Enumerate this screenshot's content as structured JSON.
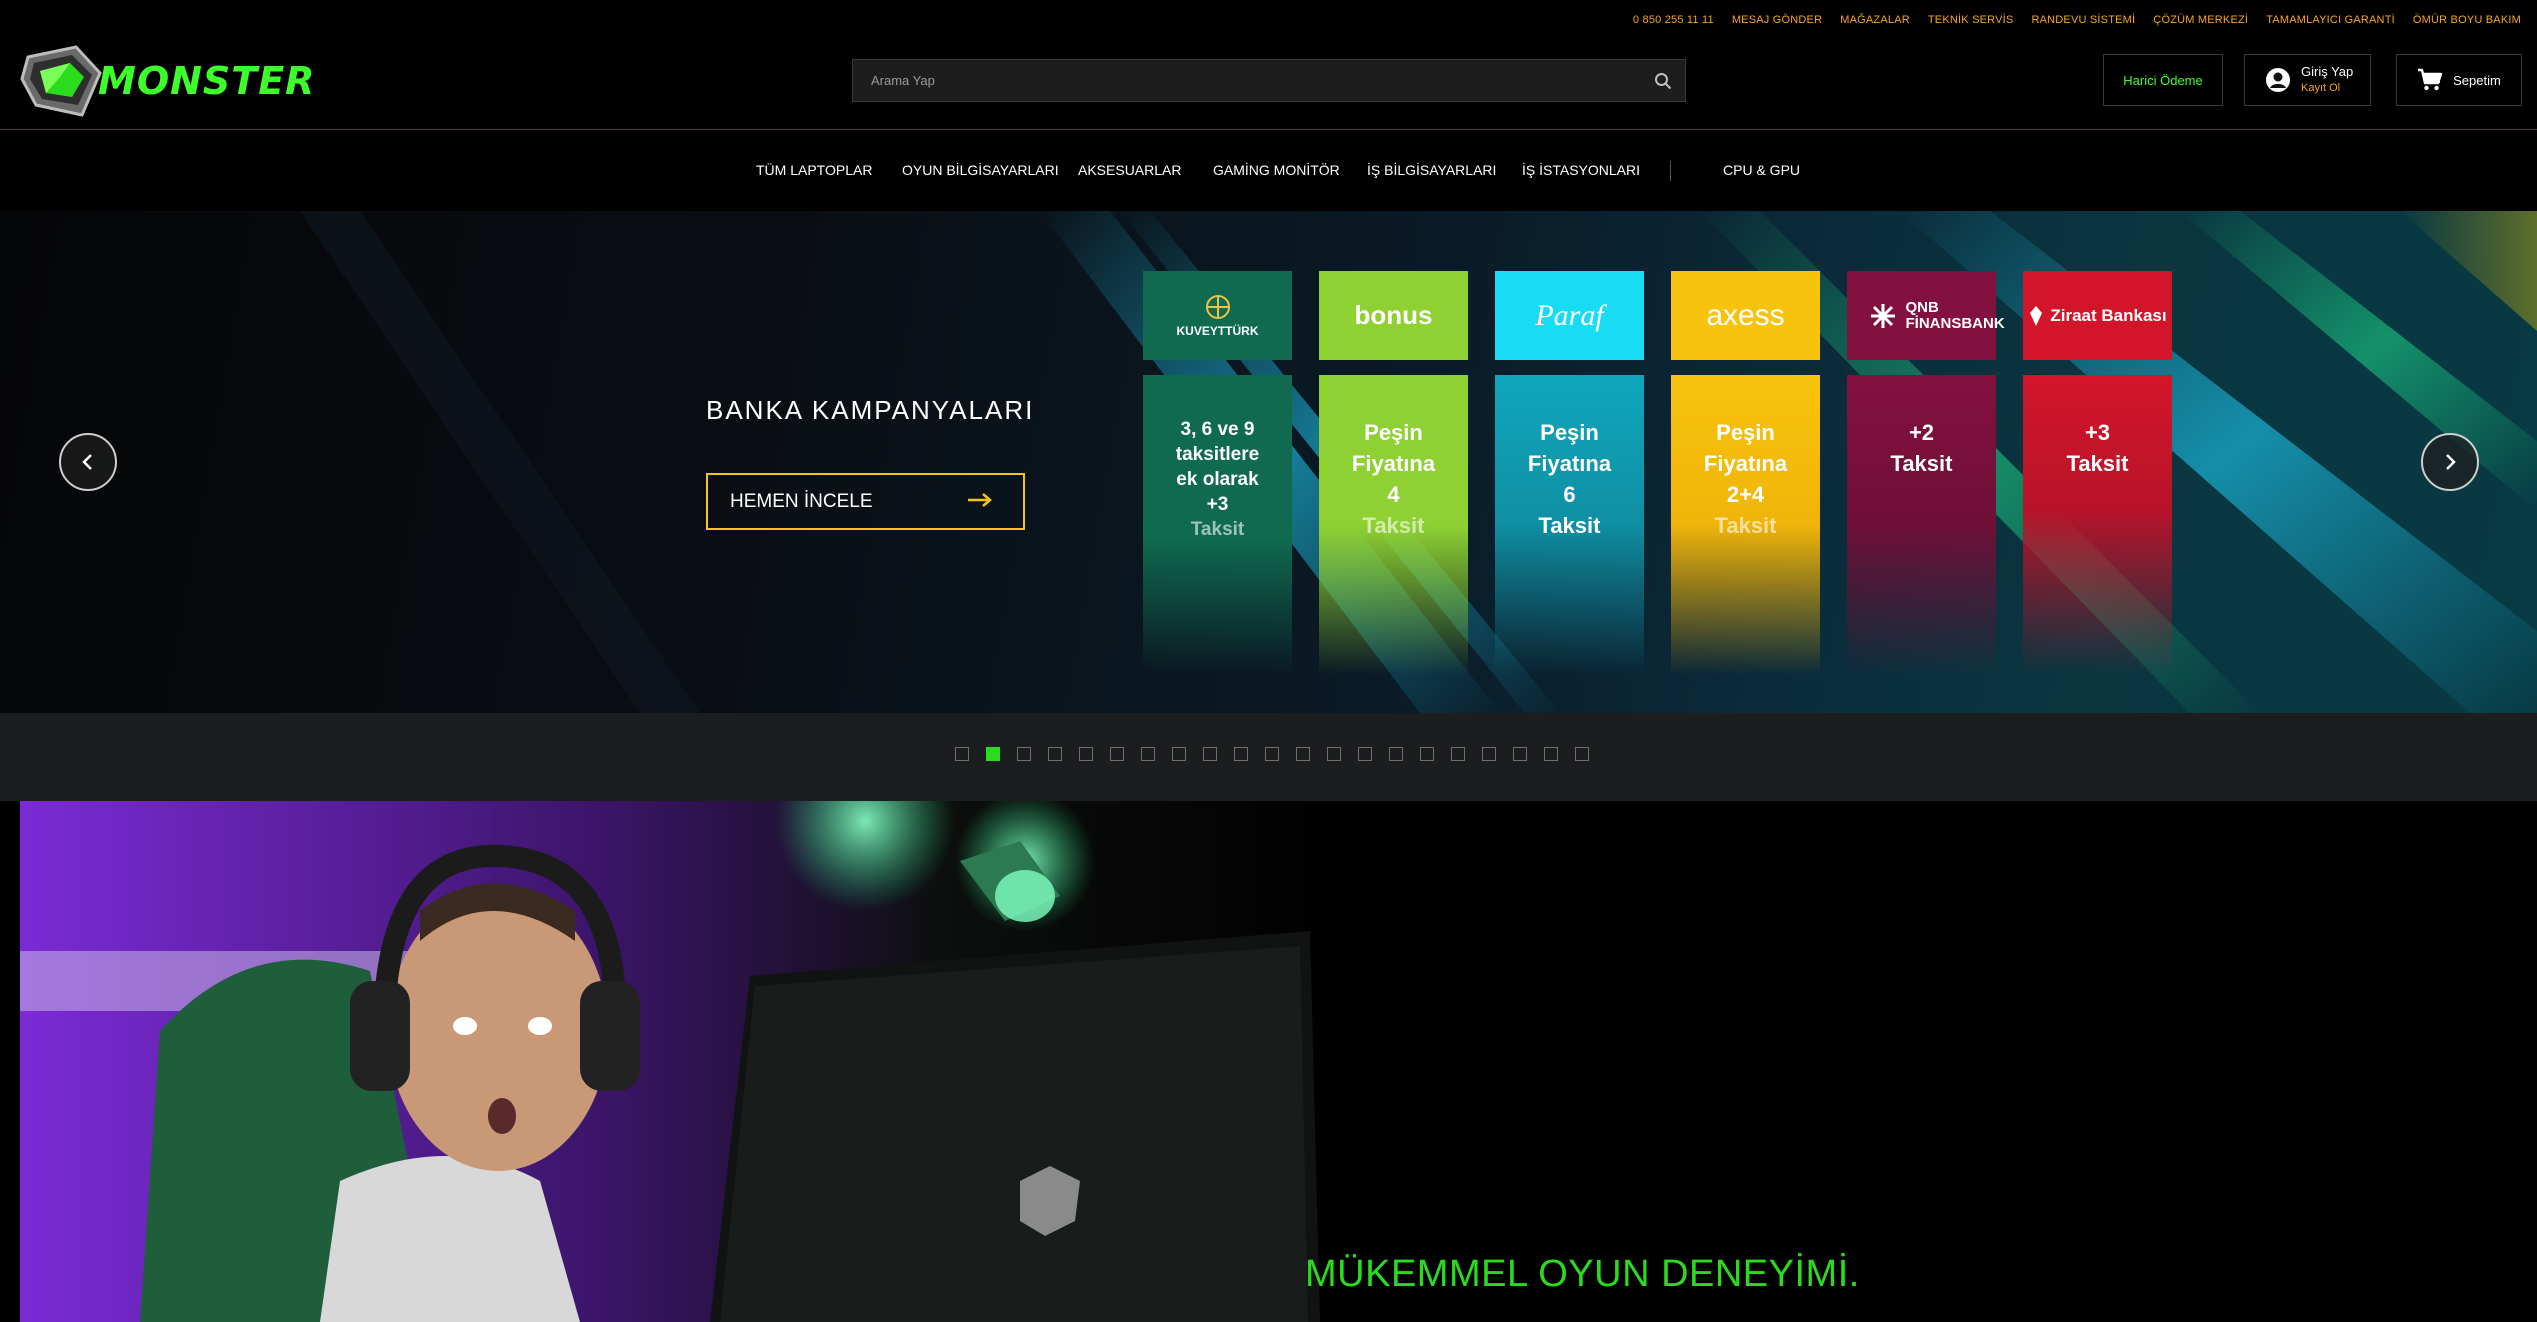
{
  "topbar": {
    "links": [
      "0 850 255 11 11",
      "MESAJ GÖNDER",
      "MAĞAZALAR",
      "TEKNİK SERVİS",
      "RANDEVU SİSTEMİ",
      "ÇÖZÜM MERKEZİ",
      "TAMAMLAYICI GARANTİ",
      "ÖMÜR BOYU BAKIM"
    ]
  },
  "header": {
    "logo_text": "MONSTER",
    "search_placeholder": "Arama Yap",
    "pay_label": "Harici Ödeme",
    "login_label": "Giriş Yap",
    "register_label": "Kayıt Ol",
    "cart_label": "Sepetim"
  },
  "nav": {
    "items": [
      "TÜM LAPTOPLAR",
      "OYUN BİLGİSAYARLARI",
      "AKSESUARLAR",
      "GAMİNG MONİTÖR",
      "İŞ BİLGİSAYARLARI",
      "İŞ İSTASYONLARI",
      "CPU & GPU"
    ]
  },
  "hero": {
    "title": "BANKA KAMPANYALARI",
    "cta": "HEMEN İNCELE",
    "banks": [
      {
        "logo": "KUVEYTTÜRK",
        "lines": [
          "3, 6 ve 9",
          "taksitlere",
          "ek olarak",
          "+3",
          "Taksit"
        ],
        "color": "#0f6a4f",
        "text": "#ffffff"
      },
      {
        "logo": "bonus",
        "lines": [
          "Peşin",
          "Fiyatına",
          "4",
          "Taksit"
        ],
        "color": "#8fd132",
        "text": "#ffffff"
      },
      {
        "logo": "Paraf",
        "lines": [
          "Peşin",
          "Fiyatına",
          "6",
          "Taksit"
        ],
        "color": "#0fa7bd",
        "text": "#ffffff"
      },
      {
        "logo": "axess",
        "lines": [
          "Peşin",
          "Fiyatına",
          "2+4",
          "Taksit"
        ],
        "color": "#f8c30c",
        "text": "#ffffff"
      },
      {
        "logo": "QNB FİNANSBANK",
        "lines": [
          "+2",
          "Taksit"
        ],
        "color": "#83113f",
        "text": "#ffffff"
      },
      {
        "logo": "Ziraat Bankası",
        "lines": [
          "+3",
          "Taksit"
        ],
        "color": "#d3152b",
        "text": "#ffffff"
      }
    ]
  },
  "slider": {
    "count": 21,
    "active_index": 1
  },
  "promo": {
    "title": "MÜKEMMEL OYUN DENEYİMİ."
  },
  "colors": {
    "accent_green": "#2bdc1e",
    "accent_orange": "#f5a623",
    "cta_border": "#f5c518"
  }
}
